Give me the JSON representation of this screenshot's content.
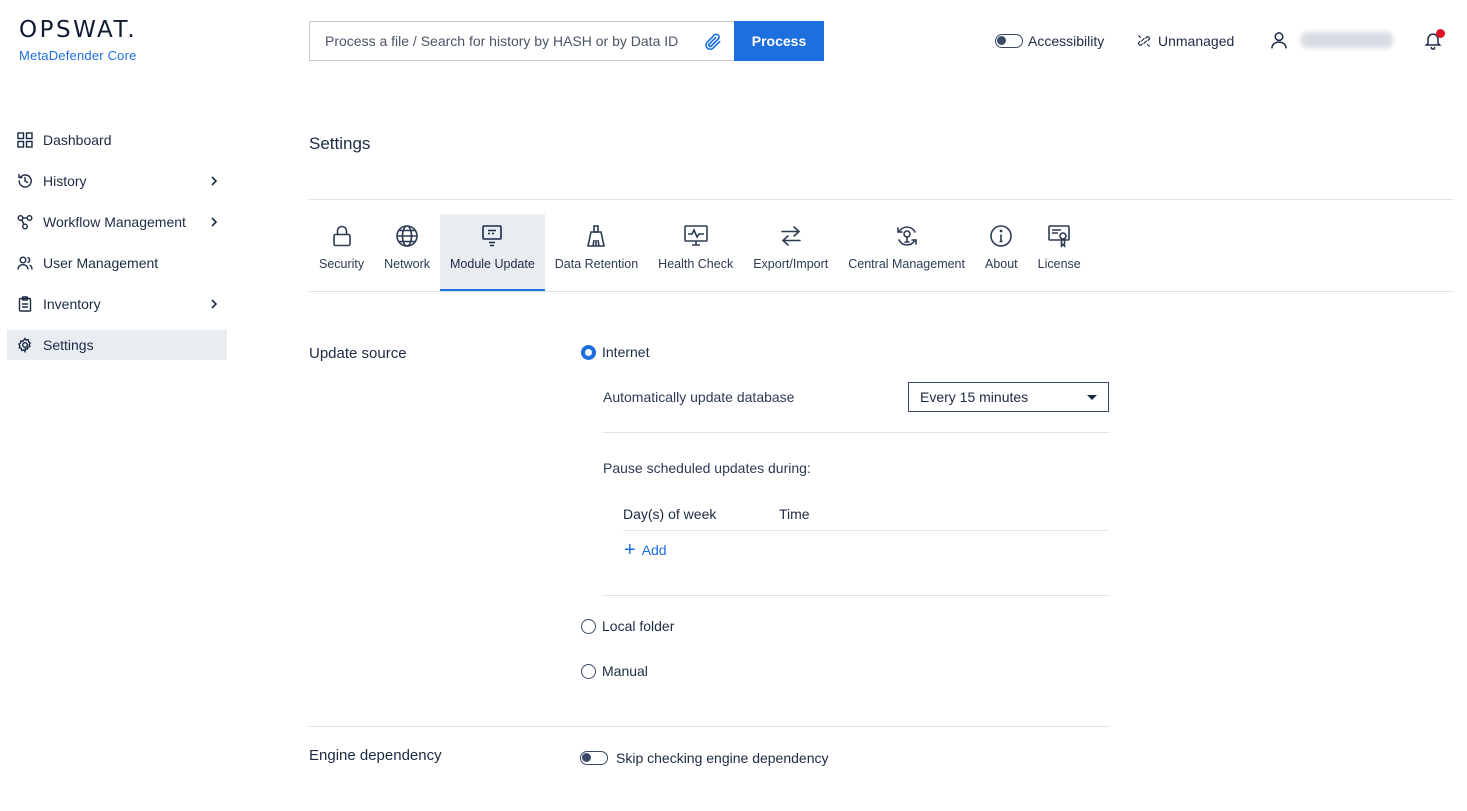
{
  "logo": {
    "word": "OPSWAT.",
    "sub": "MetaDefender Core"
  },
  "search": {
    "placeholder": "Process a file / Search for history by HASH or by Data ID",
    "process_label": "Process"
  },
  "header": {
    "accessibility_label": "Accessibility",
    "unmanaged_label": "Unmanaged"
  },
  "sidebar": {
    "items": [
      {
        "label": "Dashboard",
        "icon": "grid-icon"
      },
      {
        "label": "History",
        "icon": "history-icon"
      },
      {
        "label": "Workflow Management",
        "icon": "workflow-icon"
      },
      {
        "label": "User Management",
        "icon": "users-icon"
      },
      {
        "label": "Inventory",
        "icon": "clipboard-icon"
      },
      {
        "label": "Settings",
        "icon": "gear-icon"
      }
    ]
  },
  "main": {
    "title": "Settings",
    "tabs": [
      {
        "label": "Security"
      },
      {
        "label": "Network"
      },
      {
        "label": "Module Update"
      },
      {
        "label": "Data Retention"
      },
      {
        "label": "Health Check"
      },
      {
        "label": "Export/Import"
      },
      {
        "label": "Central Management"
      },
      {
        "label": "About"
      },
      {
        "label": "License"
      }
    ],
    "update_source": {
      "label": "Update source",
      "internet_label": "Internet",
      "auto_update_label": "Automatically update database",
      "auto_update_value": "Every 15 minutes",
      "pause_label": "Pause scheduled updates during:",
      "col_days": "Day(s) of week",
      "col_time": "Time",
      "add_label": "Add",
      "local_folder_label": "Local folder",
      "manual_label": "Manual"
    },
    "engine_dependency": {
      "label": "Engine dependency",
      "skip_label": "Skip checking engine dependency"
    }
  },
  "colors": {
    "accent": "#1d6fe0",
    "notification": "#e0142b"
  }
}
